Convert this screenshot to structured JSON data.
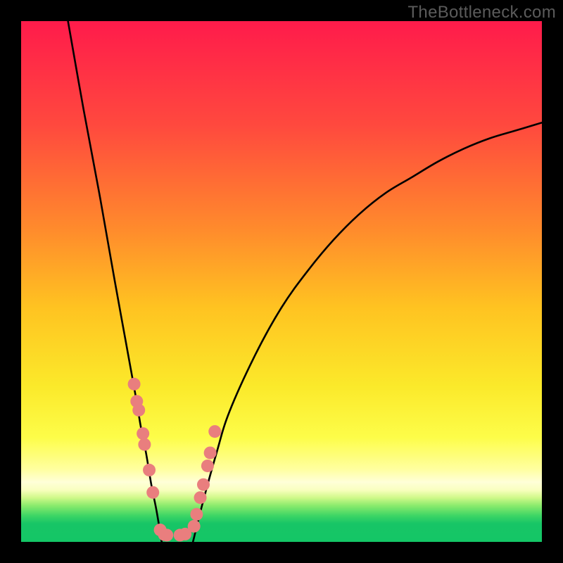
{
  "watermark": "TheBottleneck.com",
  "chart_data": {
    "type": "line",
    "title": "",
    "xlabel": "",
    "ylabel": "",
    "xlim": [
      0,
      100
    ],
    "ylim": [
      0,
      100
    ],
    "legend": false,
    "grid": false,
    "series": [
      {
        "name": "curve-left",
        "x": [
          9,
          12,
          15,
          18,
          20,
          22,
          23,
          24,
          25,
          26,
          27
        ],
        "values": [
          100,
          83,
          67,
          50,
          39,
          28,
          22,
          17,
          11,
          6,
          0
        ]
      },
      {
        "name": "curve-right",
        "x": [
          33,
          35,
          37.5,
          40,
          45,
          50,
          55,
          60,
          65,
          70,
          75,
          80,
          85,
          90,
          95,
          100
        ],
        "values": [
          0,
          8,
          17,
          25,
          36,
          45,
          52,
          58,
          63,
          67,
          70,
          73,
          75.5,
          77.5,
          79,
          80.5
        ]
      }
    ],
    "markers": {
      "name": "dots",
      "x": [
        21.7,
        22.2,
        22.6,
        23.4,
        23.7,
        24.6,
        25.3,
        26.7,
        27.5,
        28.0,
        30.5,
        31.5,
        33.2,
        33.7,
        34.4,
        35.0,
        35.8,
        36.3,
        37.2
      ],
      "y": [
        30.3,
        27.0,
        25.3,
        20.8,
        18.7,
        13.8,
        9.5,
        2.3,
        1.4,
        1.3,
        1.3,
        1.5,
        3.0,
        5.3,
        8.5,
        11.0,
        14.6,
        17.1,
        21.2
      ],
      "color": "#e97e7e",
      "radius_px": 9
    },
    "background_gradient": {
      "stops": [
        {
          "pos": 0.0,
          "color": "#ff1b4b"
        },
        {
          "pos": 0.2,
          "color": "#ff493e"
        },
        {
          "pos": 0.4,
          "color": "#ff8b2c"
        },
        {
          "pos": 0.55,
          "color": "#ffc321"
        },
        {
          "pos": 0.7,
          "color": "#fbe92a"
        },
        {
          "pos": 0.8,
          "color": "#fdfd49"
        },
        {
          "pos": 0.86,
          "color": "#ffff9f"
        },
        {
          "pos": 0.885,
          "color": "#ffffd8"
        },
        {
          "pos": 0.9,
          "color": "#f9ffc0"
        },
        {
          "pos": 0.915,
          "color": "#d0f98a"
        },
        {
          "pos": 0.93,
          "color": "#8ceb6d"
        },
        {
          "pos": 0.95,
          "color": "#3cd565"
        },
        {
          "pos": 0.965,
          "color": "#17c566"
        },
        {
          "pos": 1.0,
          "color": "#14c666"
        }
      ]
    }
  }
}
